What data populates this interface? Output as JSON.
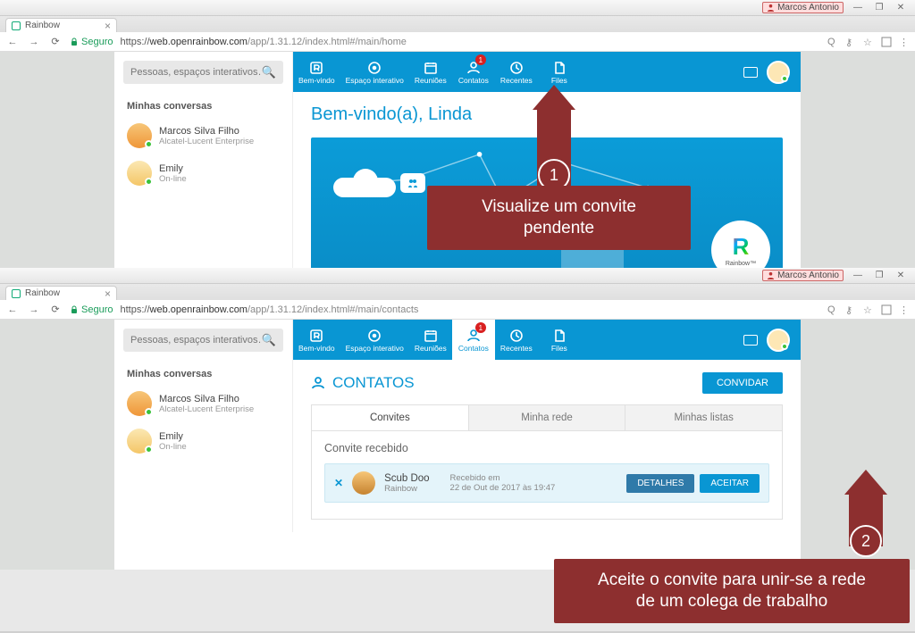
{
  "os": {
    "user": "Marcos Antonio",
    "min": "—",
    "max": "❐",
    "close": "✕"
  },
  "browser": {
    "tabTitle": "Rainbow",
    "secureLabel": "Seguro",
    "urlHost": "web.openrainbow.com",
    "urlPathHome": "https://web.openrainbow.com/app/1.31.12/index.html#/main/home",
    "urlPathContacts": "https://web.openrainbow.com/app/1.31.12/index.html#/main/contacts"
  },
  "sidebar": {
    "searchPlaceholder": "Pessoas, espaços interativos…",
    "title": "Minhas conversas",
    "conversations": [
      {
        "name": "Marcos Silva Filho",
        "sub": "Alcatel-Lucent Enterprise",
        "online": true
      },
      {
        "name": "Emily",
        "sub": "On-line",
        "online": true
      }
    ]
  },
  "nav": {
    "items": [
      {
        "label": "Bem-vindo",
        "icon": "logo"
      },
      {
        "label": "Espaço interativo",
        "icon": "target"
      },
      {
        "label": "Reuniões",
        "icon": "calendar"
      },
      {
        "label": "Contatos",
        "icon": "person",
        "badge": "1"
      },
      {
        "label": "Recentes",
        "icon": "clock"
      },
      {
        "label": "Files",
        "icon": "file"
      }
    ]
  },
  "home": {
    "welcome": "Bem-vindo(a), Linda",
    "logoLabel": "Rainbow™"
  },
  "contacts": {
    "heading": "CONTATOS",
    "inviteBtn": "CONVIDAR",
    "tabs": {
      "invites": "Convites",
      "network": "Minha rede",
      "lists": "Minhas listas"
    },
    "sectionTitle": "Convite recebido",
    "invite": {
      "name": "Scub Doo",
      "company": "Rainbow",
      "rcvLabel": "Recebido em",
      "rcvDate": "22 de Out de 2017 às 19:47",
      "details": "DETALHES",
      "accept": "ACEITAR"
    }
  },
  "annot": {
    "step1no": "1",
    "step1text1": "Visualize um convite",
    "step1text2": "pendente",
    "step2no": "2",
    "step2text1": "Aceite o convite para unir-se a rede",
    "step2text2": "de um colega de trabalho"
  }
}
